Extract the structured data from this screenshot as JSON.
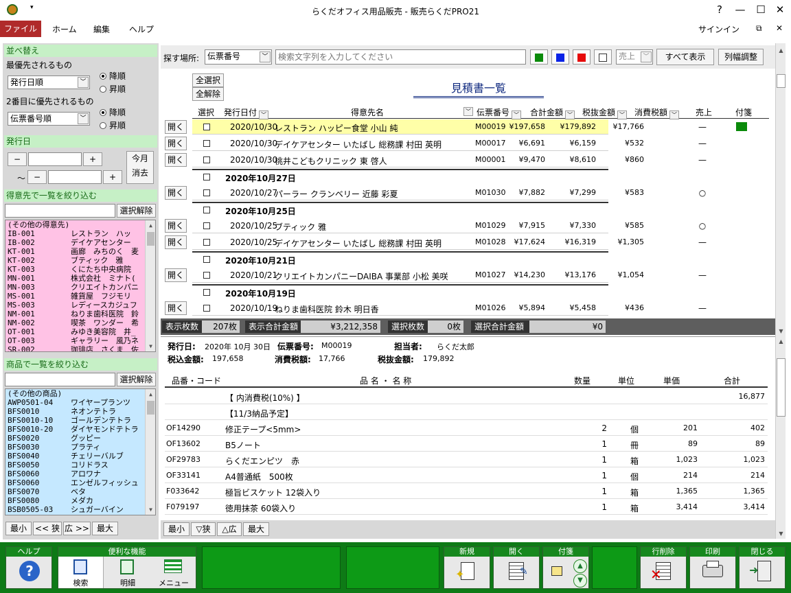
{
  "window": {
    "title": "らくだオフィス用品販売 - 販売らくだPRO21",
    "help": "?",
    "minimize": "—",
    "maximize": "☐",
    "close": "✕"
  },
  "menu": {
    "file": "ファイル",
    "home": "ホーム",
    "edit": "編集",
    "help": "ヘルプ",
    "signin": "サインイン"
  },
  "sort": {
    "header": "並べ替え",
    "first_label": "最優先されるもの",
    "first_value": "発行日順",
    "desc": "降順",
    "asc": "昇順",
    "second_label": "2番目に優先されるもの",
    "second_value": "伝票番号順"
  },
  "date_filter": {
    "header": "発行日",
    "minus": "−",
    "plus": "+",
    "tilde": "〜",
    "this_month": "今月",
    "clear": "消去"
  },
  "customer_filter": {
    "header": "得意先で一覧を絞り込む",
    "clear_btn": "選択解除",
    "items": [
      {
        "code": "(その他の得意先)",
        "name": ""
      },
      {
        "code": "IB-001",
        "name": "レストラン　ハッ"
      },
      {
        "code": "IB-002",
        "name": "デイケアセンター"
      },
      {
        "code": "KT-001",
        "name": "画廊　みちのく　麦"
      },
      {
        "code": "KT-002",
        "name": "ブティック　雅"
      },
      {
        "code": "KT-003",
        "name": "くにたち中央病院"
      },
      {
        "code": "MN-001",
        "name": "株式会社　ミナト("
      },
      {
        "code": "MN-003",
        "name": "クリエイトカンパニ"
      },
      {
        "code": "MS-001",
        "name": "雑貨屋　フジモリ"
      },
      {
        "code": "MS-003",
        "name": "レディースカジュフ"
      },
      {
        "code": "NM-001",
        "name": "ねりま歯科医院　鈴"
      },
      {
        "code": "NM-002",
        "name": "喫茶　ワンダー　希"
      },
      {
        "code": "OT-001",
        "name": "みゆき美容院　井_"
      },
      {
        "code": "OT-003",
        "name": "ギャラリー　風乃ネ"
      },
      {
        "code": "SR-002",
        "name": "珈琲店　さくま　佐"
      }
    ]
  },
  "product_filter": {
    "header": "商品で一覧を絞り込む",
    "clear_btn": "選択解除",
    "items": [
      {
        "code": "(その他の商品)",
        "name": ""
      },
      {
        "code": "AWP0501-04",
        "name": "ワイヤープランツ"
      },
      {
        "code": "BFS0010",
        "name": "ネオンテトラ"
      },
      {
        "code": "BFS0010-10",
        "name": "ゴールデンテトラ"
      },
      {
        "code": "BFS0010-20",
        "name": "ダイヤモンドテトラ"
      },
      {
        "code": "BFS0020",
        "name": "グッピー"
      },
      {
        "code": "BFS0030",
        "name": "プラティ"
      },
      {
        "code": "BFS0040",
        "name": "チェリーバルブ"
      },
      {
        "code": "BFS0050",
        "name": "コリドラス"
      },
      {
        "code": "BFS0060",
        "name": "アロワナ"
      },
      {
        "code": "BFS0060",
        "name": "エンゼルフィッシュ"
      },
      {
        "code": "BFS0070",
        "name": "ベタ"
      },
      {
        "code": "BFS0080",
        "name": "メダカ"
      },
      {
        "code": "BSB0505-03",
        "name": "シュガーバイン"
      }
    ]
  },
  "left_zoom": {
    "min": "最小",
    "narrow": "<< 狭",
    "wide": "広 >>",
    "max": "最大"
  },
  "search": {
    "label": "探す場所:",
    "field": "伝票番号",
    "placeholder": "検索文字列を入力してください",
    "sales_filter": "売上",
    "show_all": "すべて表示",
    "col_width": "列幅調整",
    "colors": {
      "green": "#0a8a0a",
      "blue": "#0a23e6",
      "red": "#e60a0a"
    }
  },
  "list": {
    "select_all": "全選択",
    "deselect_all": "全解除",
    "title": "見積書一覧",
    "headers": {
      "select": "選択",
      "date": "発行日付",
      "customer": "得意先名",
      "slip": "伝票番号",
      "total": "合計金額",
      "pretax": "税抜金額",
      "tax": "消費税額",
      "sales": "売上",
      "tag": "付箋"
    },
    "open_label": "開く",
    "rows": [
      {
        "date": "2020/10/30",
        "customer": "レストラン ハッピー食堂 小山 純",
        "slip": "M00019",
        "total": "¥197,658",
        "pretax": "¥179,892",
        "tax": "¥17,766",
        "sales": "—",
        "tag": "green"
      },
      {
        "date": "2020/10/30",
        "customer": "デイケアセンター いたばし 総務課 村田 英明",
        "slip": "M00017",
        "total": "¥6,691",
        "pretax": "¥6,159",
        "tax": "¥532",
        "sales": "—",
        "tag": ""
      },
      {
        "date": "2020/10/30",
        "customer": "桃井こどもクリニック 東 啓人",
        "slip": "M00001",
        "total": "¥9,470",
        "pretax": "¥8,610",
        "tax": "¥860",
        "sales": "—",
        "tag": ""
      },
      {
        "group": "2020年10月27日"
      },
      {
        "date": "2020/10/27",
        "customer": "パーラー クランベリー 近藤 彩夏",
        "slip": "M01030",
        "total": "¥7,882",
        "pretax": "¥7,299",
        "tax": "¥583",
        "sales": "○",
        "tag": ""
      },
      {
        "group": "2020年10月25日"
      },
      {
        "date": "2020/10/25",
        "customer": "ブティック 雅",
        "slip": "M01029",
        "total": "¥7,915",
        "pretax": "¥7,330",
        "tax": "¥585",
        "sales": "○",
        "tag": ""
      },
      {
        "date": "2020/10/25",
        "customer": "デイケアセンター いたばし 総務課 村田 英明",
        "slip": "M01028",
        "total": "¥17,624",
        "pretax": "¥16,319",
        "tax": "¥1,305",
        "sales": "—",
        "tag": ""
      },
      {
        "group": "2020年10月21日"
      },
      {
        "date": "2020/10/21",
        "customer": "クリエイトカンパニーDAIBA 事業部 小松 美咲",
        "slip": "M01027",
        "total": "¥14,230",
        "pretax": "¥13,176",
        "tax": "¥1,054",
        "sales": "—",
        "tag": ""
      },
      {
        "group": "2020年10月19日"
      },
      {
        "date": "2020/10/19",
        "customer": "ねりま歯科医院 鈴木 明日香",
        "slip": "M01026",
        "total": "¥5,894",
        "pretax": "¥5,458",
        "tax": "¥436",
        "sales": "—",
        "tag": ""
      }
    ]
  },
  "status": {
    "count_label": "表示枚数",
    "count_value": "207枚",
    "total_label": "表示合計金額",
    "total_value": "¥3,212,358",
    "sel_count_label": "選択枚数",
    "sel_count_value": "0枚",
    "sel_total_label": "選択合計金額",
    "sel_total_value": "¥0"
  },
  "detail": {
    "date_label": "発行日:",
    "date_value": "2020年 10月 30日",
    "slip_label": "伝票番号:",
    "slip_value": "M00019",
    "staff_label": "担当者:",
    "staff_value": "らくだ太郎",
    "taxin_label": "税込金額:",
    "taxin_value": "197,658",
    "tax_label": "消費税額:",
    "tax_value": "17,766",
    "taxex_label": "税抜金額:",
    "taxex_value": "179,892",
    "headers": {
      "code": "品番・コード",
      "name": "品 名 ・ 名 称",
      "qty": "数量",
      "unit": "単位",
      "price": "単価",
      "amount": "合計"
    },
    "rows": [
      {
        "code": "",
        "name": "【 内消費税(10%) 】",
        "qty": "",
        "unit": "",
        "price": "",
        "amount": "16,877"
      },
      {
        "code": "",
        "name": "【11/3納品予定】",
        "qty": "",
        "unit": "",
        "price": "",
        "amount": ""
      },
      {
        "code": "OF14290",
        "name": "修正テープ<5mm>",
        "qty": "2",
        "unit": "個",
        "price": "201",
        "amount": "402"
      },
      {
        "code": "OF13602",
        "name": "B5ノート",
        "qty": "1",
        "unit": "冊",
        "price": "89",
        "amount": "89"
      },
      {
        "code": "OF29783",
        "name": "らくだエンピツ　赤",
        "qty": "1",
        "unit": "箱",
        "price": "1,023",
        "amount": "1,023"
      },
      {
        "code": "OF33141",
        "name": "A4普通紙　500枚",
        "qty": "1",
        "unit": "個",
        "price": "214",
        "amount": "214"
      },
      {
        "code": "F033642",
        "name": "極旨ビスケット 12袋入り",
        "qty": "1",
        "unit": "箱",
        "price": "1,365",
        "amount": "1,365"
      },
      {
        "code": "F079197",
        "name": "徳用抹茶 60袋入り",
        "qty": "1",
        "unit": "箱",
        "price": "3,414",
        "amount": "3,414"
      }
    ]
  },
  "detail_zoom": {
    "min": "最小",
    "narrow": "▽狭",
    "wide": "△広",
    "max": "最大"
  },
  "bottom": {
    "help": "ヘルプ",
    "tools": "便利な機能",
    "search": "検索",
    "details": "明細",
    "menu": "メニュー",
    "new": "新規",
    "open": "開く",
    "tag": "付箋",
    "delete_row": "行削除",
    "print": "印刷",
    "close": "閉じる"
  }
}
